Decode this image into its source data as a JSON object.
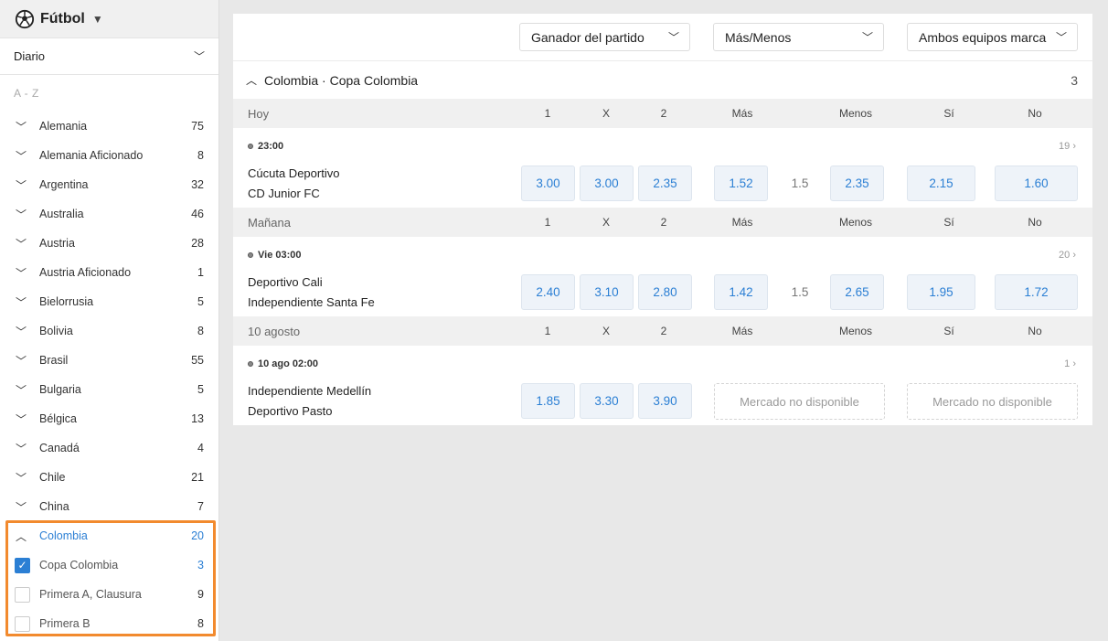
{
  "sport": {
    "title": "Fútbol",
    "icon": "soccer-ball-icon"
  },
  "period": {
    "label": "Diario"
  },
  "az_label": "A - Z",
  "countries": [
    {
      "name": "Alemania",
      "count": "75"
    },
    {
      "name": "Alemania Aficionado",
      "count": "8"
    },
    {
      "name": "Argentina",
      "count": "32"
    },
    {
      "name": "Australia",
      "count": "46"
    },
    {
      "name": "Austria",
      "count": "28"
    },
    {
      "name": "Austria Aficionado",
      "count": "1"
    },
    {
      "name": "Bielorrusia",
      "count": "5"
    },
    {
      "name": "Bolivia",
      "count": "8"
    },
    {
      "name": "Brasil",
      "count": "55"
    },
    {
      "name": "Bulgaria",
      "count": "5"
    },
    {
      "name": "Bélgica",
      "count": "13"
    },
    {
      "name": "Canadá",
      "count": "4"
    },
    {
      "name": "Chile",
      "count": "21"
    },
    {
      "name": "China",
      "count": "7"
    },
    {
      "name": "Colombia",
      "count": "20"
    }
  ],
  "leagues": [
    {
      "name": "Copa Colombia",
      "count": "3",
      "checked": true
    },
    {
      "name": "Primera A, Clausura",
      "count": "9",
      "checked": false
    },
    {
      "name": "Primera B",
      "count": "8",
      "checked": false
    }
  ],
  "markets": [
    {
      "label": "Ganador del partido"
    },
    {
      "label": "Más/Menos"
    },
    {
      "label": "Ambos equipos marcan"
    }
  ],
  "competition": {
    "title": "Colombia · Copa Colombia",
    "count": "3"
  },
  "column_headers": {
    "h1": "1",
    "hx": "X",
    "h2": "2",
    "mas": "Más",
    "menos": "Menos",
    "si": "Sí",
    "no": "No"
  },
  "days": [
    {
      "label": "Hoy",
      "match": {
        "time": "23:00",
        "more": "19",
        "home": "Cúcuta Deportivo",
        "away": "CD Junior FC",
        "odds_1": "3.00",
        "odds_x": "3.00",
        "odds_2": "2.35",
        "over": "1.52",
        "line": "1.5",
        "under": "2.35",
        "yes": "2.15",
        "no": "1.60"
      }
    },
    {
      "label": "Mañana",
      "match": {
        "time": "Vie 03:00",
        "more": "20",
        "home": "Deportivo Cali",
        "away": "Independiente Santa Fe",
        "odds_1": "2.40",
        "odds_x": "3.10",
        "odds_2": "2.80",
        "over": "1.42",
        "line": "1.5",
        "under": "2.65",
        "yes": "1.95",
        "no": "1.72"
      }
    },
    {
      "label": "10 agosto",
      "match": {
        "time": "10 ago 02:00",
        "more": "1",
        "home": "Independiente Medellín",
        "away": "Deportivo Pasto",
        "odds_1": "1.85",
        "odds_x": "3.30",
        "odds_2": "3.90",
        "unavailable_1": "Mercado no disponible",
        "unavailable_2": "Mercado no disponible"
      }
    }
  ],
  "colors": {
    "accent": "#2b7fd4",
    "highlight": "#f28a2e"
  }
}
